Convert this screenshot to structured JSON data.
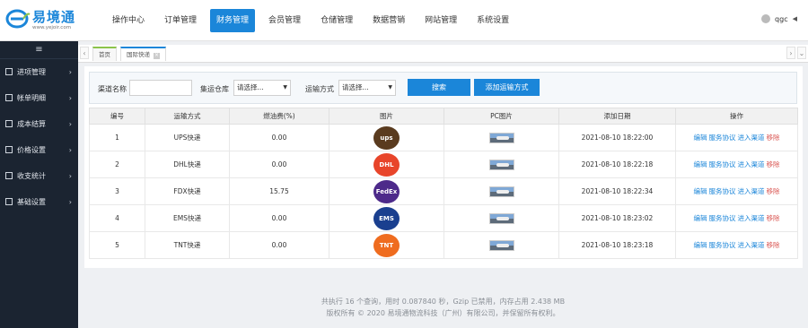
{
  "header": {
    "logo_text": "易境通",
    "logo_url": "www.yejoir.com",
    "nav": [
      "操作中心",
      "订单管理",
      "财务管理",
      "会员管理",
      "仓储管理",
      "数据营销",
      "网站管理",
      "系统设置"
    ],
    "active_nav": "财务管理",
    "user_name": "qgc"
  },
  "sidebar": {
    "toggle": "≡",
    "items": [
      "进项管理",
      "帐单明细",
      "成本结算",
      "价格设置",
      "收支统计",
      "基础设置"
    ]
  },
  "tabs": {
    "home": "首页",
    "active": "国际快递"
  },
  "search": {
    "channel_label": "渠道名称",
    "warehouse_label": "集运仓库",
    "warehouse_value": "请选择...",
    "transport_label": "运输方式",
    "transport_value": "请选择...",
    "search_button": "搜索",
    "add_button": "添加运输方式"
  },
  "table": {
    "headers": [
      "编号",
      "运输方式",
      "燃油费(%)",
      "图片",
      "PC图片",
      "添加日期",
      "操作"
    ],
    "rows": [
      {
        "id": "1",
        "method": "UPS快递",
        "fuel": "0.00",
        "logo": "ups",
        "date": "2021-08-10 18:22:00"
      },
      {
        "id": "2",
        "method": "DHL快递",
        "fuel": "0.00",
        "logo": "dhl",
        "date": "2021-08-10 18:22:18"
      },
      {
        "id": "3",
        "method": "FDX快递",
        "fuel": "15.75",
        "logo": "fedex",
        "date": "2021-08-10 18:22:34"
      },
      {
        "id": "4",
        "method": "EMS快递",
        "fuel": "0.00",
        "logo": "ems",
        "date": "2021-08-10 18:23:02"
      },
      {
        "id": "5",
        "method": "TNT快递",
        "fuel": "0.00",
        "logo": "tnt",
        "date": "2021-08-10 18:23:18"
      }
    ],
    "ops": [
      "编辑",
      "服务协议",
      "进入渠道",
      "移除"
    ]
  },
  "footer": {
    "line1": "共执行 16 个查询，用时 0.087840 秒，Gzip 已禁用，内存占用 2.438 MB",
    "line2": "版权所有 © 2020 易境通物流科技（广州）有限公司，并保留所有权利。"
  },
  "colors": {
    "accent": "#1b86d9",
    "sidebar": "#1b2431",
    "ups": "#5a3b1f",
    "dhl": "#e8452a",
    "fedex": "#4d2a8a",
    "ems": "#1a3f8f",
    "tnt": "#ef6c1f"
  },
  "logo_labels": {
    "ups": "ups",
    "dhl": "DHL",
    "fedex": "FedEx",
    "ems": "EMS",
    "tnt": "TNT"
  }
}
